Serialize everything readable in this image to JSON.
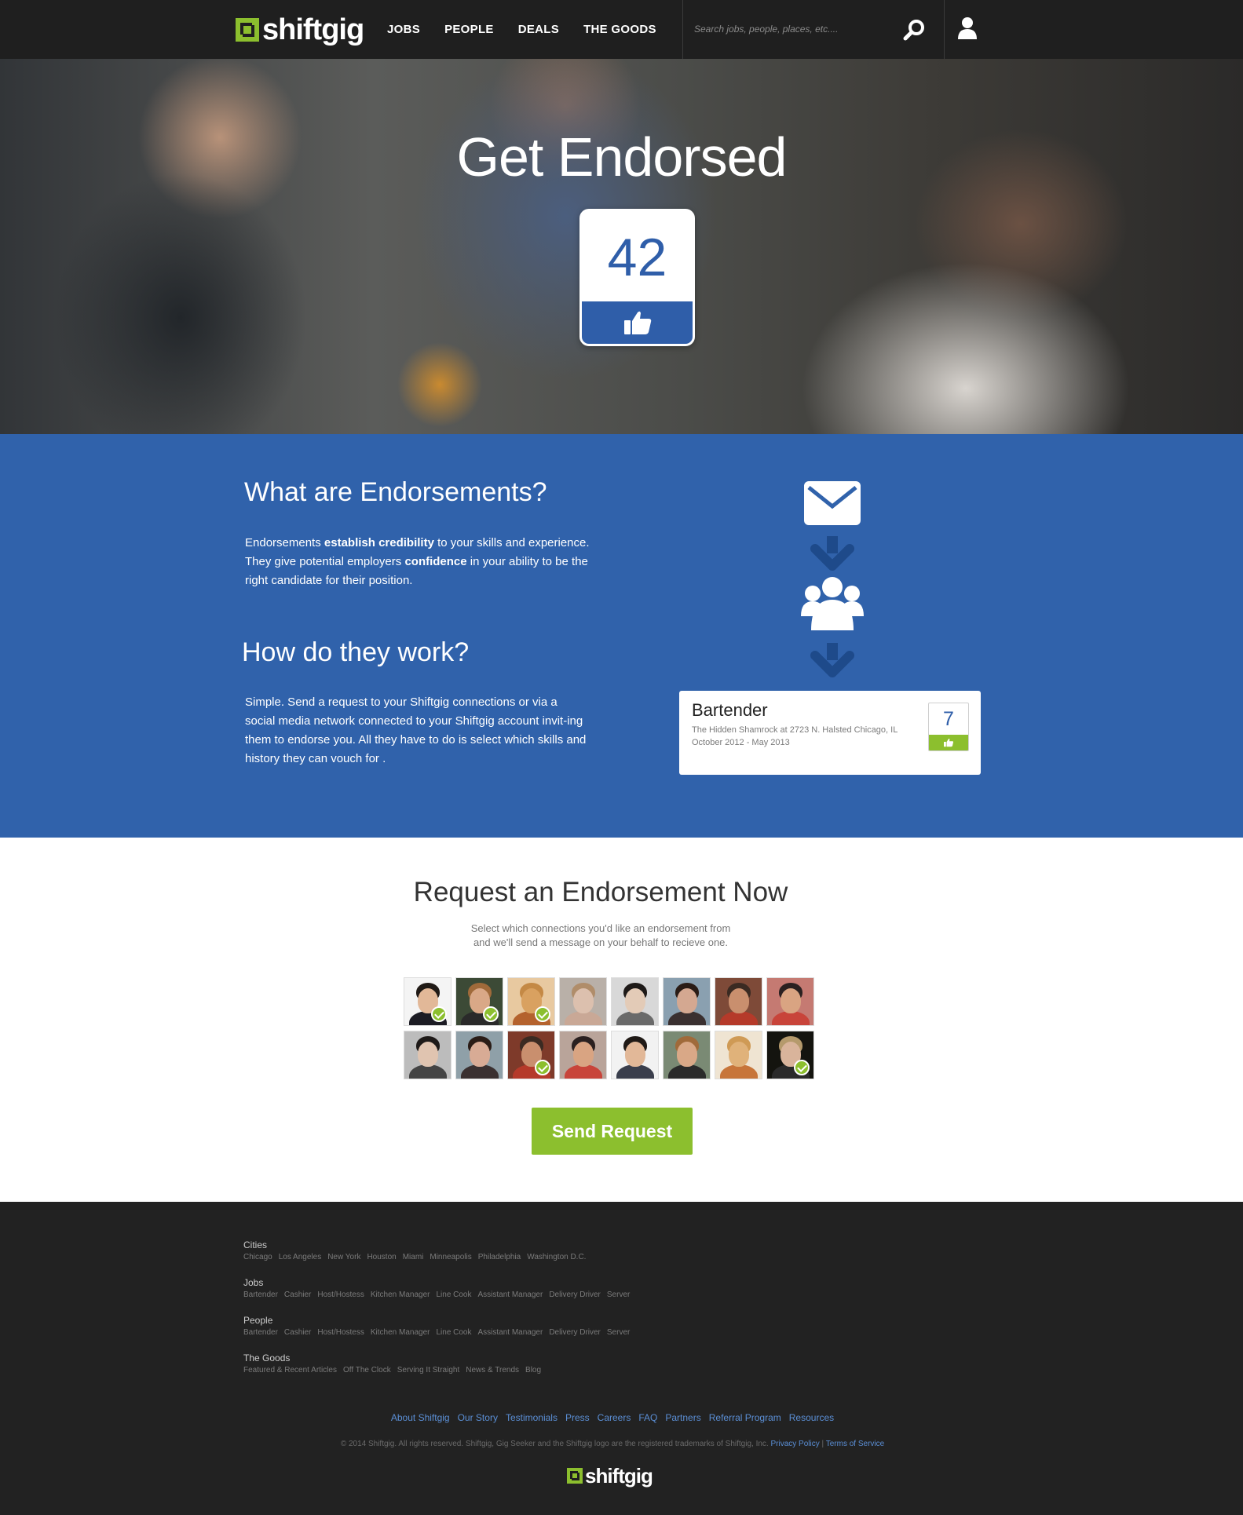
{
  "brand": {
    "name": "shiftgig",
    "accent": "#8cbf2e",
    "primary_blue": "#3062ab"
  },
  "nav": {
    "items": [
      {
        "label": "JOBS"
      },
      {
        "label": "PEOPLE"
      },
      {
        "label": "DEALS"
      },
      {
        "label": "THE GOODS"
      }
    ],
    "search_placeholder": "Search jobs, people, places, etc....",
    "search_icon": "search-icon",
    "user_icon": "user-icon"
  },
  "hero": {
    "title": "Get Endorsed",
    "badge_count": "42",
    "badge_icon": "thumbs-up-icon"
  },
  "info": {
    "what_title": "What are Endorsements?",
    "what_text": {
      "p1": "Endorsements ",
      "b1": "establish credibility",
      "p2": " to your skills and experience. They give potential employers ",
      "b2": "confidence",
      "p3": " in your ability to be the right candidate for their position."
    },
    "how_title": "How do they work?",
    "how_text": "Simple. Send a request to your Shiftgig connections or via a social media network connected to your Shiftgig account invit-ing them to endorse you. All they have to do is select which skills and history they can vouch for .",
    "flow_icons": [
      "envelope-icon",
      "arrow-down-icon",
      "group-icon",
      "arrow-down-icon"
    ],
    "card": {
      "title": "Bartender",
      "location": "The Hidden Shamrock at 2723 N. Halsted  Chicago, IL",
      "dates": "October 2012 - May 2013",
      "count": "7"
    }
  },
  "request": {
    "title": "Request an Endorsement Now",
    "subtitle_line1": "Select which connections you'd like an endorsement from",
    "subtitle_line2": "and we'll send a message on your behalf to recieve one.",
    "connections": [
      {
        "selected": true,
        "bg": "#f4f4f4",
        "skin": "#e2b898",
        "hair": "#201a16",
        "shirt": "#1c1c24"
      },
      {
        "selected": true,
        "bg": "#3c4a36",
        "skin": "#d9a887",
        "hair": "#a06a3a",
        "shirt": "#2a2a2a"
      },
      {
        "selected": true,
        "bg": "#e8c9a0",
        "skin": "#d9a160",
        "hair": "#c48945",
        "shirt": "#b4622d"
      },
      {
        "selected": false,
        "bg": "#b9b0a8",
        "skin": "#dcc0ae",
        "hair": "#b08d6a",
        "shirt": "#c9a896"
      },
      {
        "selected": false,
        "bg": "#d8d8d8",
        "skin": "#e3cbb7",
        "hair": "#1e1a18",
        "shirt": "#6a6a6a"
      },
      {
        "selected": false,
        "bg": "#8aa0b0",
        "skin": "#d4a891",
        "hair": "#2a1c16",
        "shirt": "#3a3030"
      },
      {
        "selected": false,
        "bg": "#7e4a38",
        "skin": "#c98f6e",
        "hair": "#3a2a22",
        "shirt": "#b53a2a"
      },
      {
        "selected": false,
        "bg": "#c57a72",
        "skin": "#d9a482",
        "hair": "#2a2020",
        "shirt": "#c8443a"
      },
      {
        "selected": false,
        "bg": "#bcbcbc",
        "skin": "#e0c4b0",
        "hair": "#1e1a18",
        "shirt": "#444444"
      },
      {
        "selected": false,
        "bg": "#8fa0a8",
        "skin": "#d8ab95",
        "hair": "#2a1c16",
        "shirt": "#3a3030"
      },
      {
        "selected": true,
        "bg": "#7e3a2a",
        "skin": "#c98f6e",
        "hair": "#3a2a22",
        "shirt": "#b53a2a"
      },
      {
        "selected": false,
        "bg": "#b9a49a",
        "skin": "#d9a482",
        "hair": "#2a2020",
        "shirt": "#c8443a"
      },
      {
        "selected": false,
        "bg": "#f2f2f2",
        "skin": "#e2b898",
        "hair": "#201a16",
        "shirt": "#3a3e4c"
      },
      {
        "selected": false,
        "bg": "#7a8a74",
        "skin": "#d9a887",
        "hair": "#a06a3a",
        "shirt": "#2a2a2a"
      },
      {
        "selected": false,
        "bg": "#efe4d2",
        "skin": "#e0b27a",
        "hair": "#cf9a55",
        "shirt": "#c7753a"
      },
      {
        "selected": true,
        "bg": "#14140f",
        "skin": "#d9b49b",
        "hair": "#b59a6c",
        "shirt": "#2a2a2a"
      }
    ],
    "send_label": "Send Request"
  },
  "footer": {
    "groups": [
      {
        "heading": "Cities",
        "links": [
          "Chicago",
          "Los Angeles",
          "New York",
          "Houston",
          "Miami",
          "Minneapolis",
          "Philadelphia",
          "Washington D.C."
        ]
      },
      {
        "heading": "Jobs",
        "links": [
          "Bartender",
          "Cashier",
          "Host/Hostess",
          "Kitchen Manager",
          "Line Cook",
          "Assistant Manager",
          "Delivery Driver",
          "Server"
        ]
      },
      {
        "heading": "People",
        "links": [
          "Bartender",
          "Cashier",
          "Host/Hostess",
          "Kitchen Manager",
          "Line Cook",
          "Assistant Manager",
          "Delivery Driver",
          "Server"
        ]
      },
      {
        "heading": "The Goods",
        "links": [
          "Featured & Recent Articles",
          "Off The Clock",
          "Serving It Straight",
          "News & Trends",
          "Blog"
        ]
      }
    ],
    "bottom_links": [
      "About Shiftgig",
      "Our Story",
      "Testimonials",
      "Press",
      "Careers",
      "FAQ",
      "Partners",
      "Referral Program",
      "Resources"
    ],
    "copyright": "© 2014 Shiftgig. All rights reserved. Shiftgig, Gig Seeker and the Shiftgig logo are the registered trademarks of Shiftgig, Inc.",
    "privacy_label": "Privacy Policy",
    "separator": " | ",
    "terms_label": "Terms of Service"
  }
}
